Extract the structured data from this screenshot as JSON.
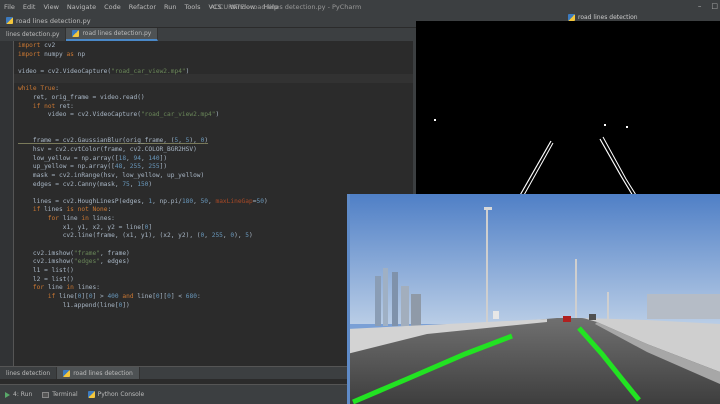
{
  "menu": {
    "items": [
      "File",
      "Edit",
      "View",
      "Navigate",
      "Code",
      "Refactor",
      "Run",
      "Tools",
      "VCS",
      "Window",
      "Help"
    ],
    "window_title": "ACCURATE - road lines detection.py - PyCharm"
  },
  "navbar": {
    "crumb": "road lines detection.py"
  },
  "editor_tabs": [
    {
      "label": "lines detection.py"
    },
    {
      "label": "road lines detection.py"
    }
  ],
  "code_lines": [
    "import cv2",
    "import numpy as np",
    "",
    "video = cv2.VideoCapture(\"road_car_view2.mp4\")",
    "",
    "while True:",
    "    ret, orig_frame = video.read()",
    "    if not ret:",
    "        video = cv2.VideoCapture(\"road_car_view2.mp4\")",
    "",
    "",
    "    frame = cv2.GaussianBlur(orig_frame, (5, 5), 0)",
    "    hsv = cv2.cvtColor(frame, cv2.COLOR_BGR2HSV)",
    "    low_yellow = np.array([18, 94, 140])",
    "    up_yellow = np.array([48, 255, 255])",
    "    mask = cv2.inRange(hsv, low_yellow, up_yellow)",
    "    edges = cv2.Canny(mask, 75, 150)",
    "",
    "    lines = cv2.HoughLinesP(edges, 1, np.pi/180, 50, maxLineGap=50)",
    "    if lines is not None:",
    "        for line in lines:",
    "            x1, y1, x2, y2 = line[0]",
    "            cv2.line(frame, (x1, y1), (x2, y2), (0, 255, 0), 5)",
    "",
    "    cv2.imshow(\"frame\", frame)",
    "    cv2.imshow(\"edges\", edges)",
    "    l1 = list()",
    "    l2 = list()",
    "    for line in lines:",
    "        if line[0][0] > 400 and line[0][0] < 680:",
    "            l1.append(line[0])"
  ],
  "run_tabs": [
    {
      "label": "lines detection"
    },
    {
      "label": "road lines detection"
    }
  ],
  "bottom_tools": [
    {
      "label": "4: Run",
      "icon": "play-icon"
    },
    {
      "label": "Terminal",
      "icon": "terminal-icon"
    },
    {
      "label": "Python Console",
      "icon": "python-icon"
    }
  ],
  "edges_window": {
    "title": "road lines detection"
  },
  "colors": {
    "ide_bg": "#2b2b2b",
    "panel": "#3c3f41",
    "keyword": "#cc7832",
    "string": "#6a8759",
    "number": "#6897bb",
    "lane_green": "#22e322"
  }
}
